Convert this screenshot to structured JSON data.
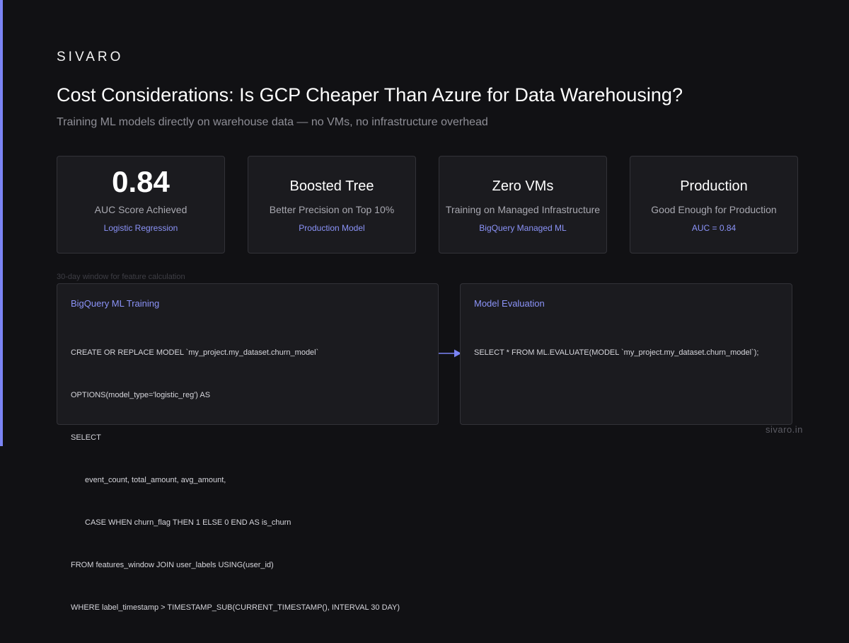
{
  "brand": "SIVARO",
  "title": "Cost Considerations: Is GCP Cheaper Than Azure for Data Warehousing?",
  "subtitle": "Training ML models directly on warehouse data — no VMs, no infrastructure overhead",
  "cards": [
    {
      "headline": "0.84",
      "description": "AUC Score Achieved",
      "tag": "Logistic Regression"
    },
    {
      "headline": "Boosted Tree",
      "description": "Better Precision on Top 10%",
      "tag": "Production Model"
    },
    {
      "headline": "Zero VMs",
      "description": "Training on Managed Infrastructure",
      "tag": "BigQuery Managed ML"
    },
    {
      "headline": "Production",
      "description": "Good Enough for Production",
      "tag": "AUC = 0.84"
    }
  ],
  "caption": "30-day window for feature calculation",
  "training_panel": {
    "title": "BigQuery ML Training",
    "lines": [
      "CREATE OR REPLACE MODEL `my_project.my_dataset.churn_model`",
      "OPTIONS(model_type='logistic_reg') AS",
      "SELECT",
      "event_count, total_amount, avg_amount,",
      "CASE WHEN churn_flag THEN 1 ELSE 0 END AS is_churn",
      "FROM features_window JOIN user_labels USING(user_id)",
      "WHERE label_timestamp > TIMESTAMP_SUB(CURRENT_TIMESTAMP(), INTERVAL 30 DAY)"
    ]
  },
  "evaluation_panel": {
    "title": "Model Evaluation",
    "lines": [
      "SELECT * FROM ML.EVALUATE(MODEL `my_project.my_dataset.churn_model`);"
    ]
  },
  "footer": "sivaro.in",
  "colors": {
    "accent": "#7b84f5",
    "background": "#111114",
    "card": "#1b1b1f",
    "tag": "#8b93f8"
  },
  "icons": {
    "flow_arrow": "arrow-right-icon"
  }
}
